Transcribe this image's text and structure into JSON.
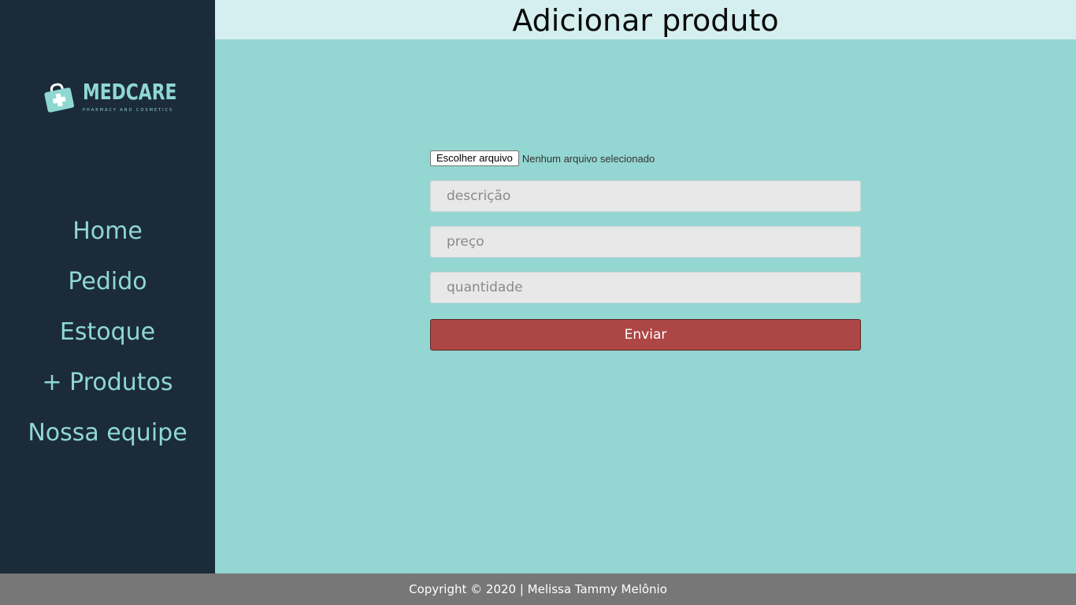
{
  "brand": {
    "name": "MEDCARE",
    "tagline": "PHARMACY AND COSMETICS",
    "color": "#8fd8d2"
  },
  "sidebar": {
    "items": [
      {
        "label": "Home"
      },
      {
        "label": "Pedido"
      },
      {
        "label": "Estoque"
      },
      {
        "label": "+ Produtos"
      },
      {
        "label": "Nossa equipe"
      }
    ]
  },
  "header": {
    "title": "Adicionar produto"
  },
  "form": {
    "file_button": "Escolher arquivo",
    "file_status": "Nenhum arquivo selecionado",
    "description_placeholder": "descrição",
    "price_placeholder": "preço",
    "quantity_placeholder": "quantidade",
    "submit_label": "Enviar"
  },
  "footer": {
    "text": "Copyright © 2020 | Melissa Tammy Melônio"
  },
  "colors": {
    "sidebar_bg": "#1b2b3a",
    "main_bg": "#94d6d2",
    "header_bg": "#d5eff0",
    "submit_bg": "#ad4745",
    "footer_bg": "#777777"
  }
}
